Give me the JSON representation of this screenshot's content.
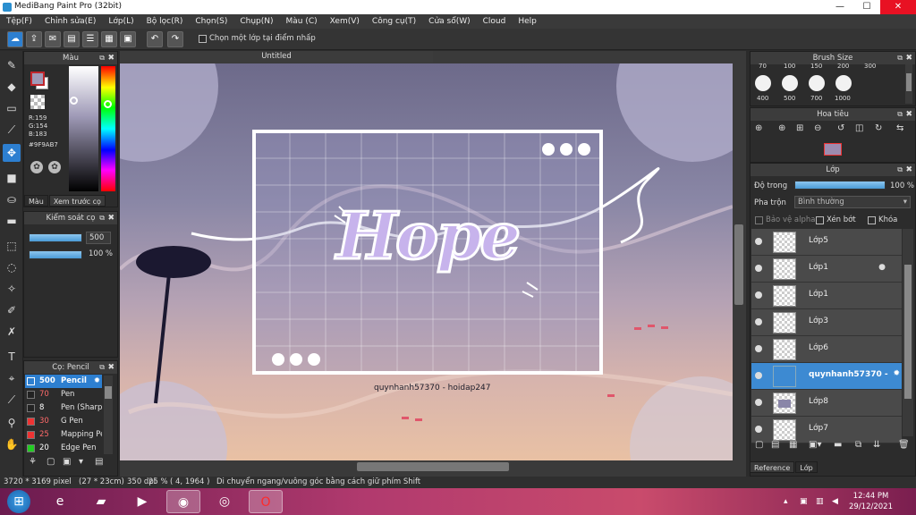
{
  "window": {
    "title": "MediBang Paint Pro (32bit)",
    "min": "—",
    "max": "☐",
    "close": "✕"
  },
  "menu": [
    "Tệp(F)",
    "Chỉnh sửa(E)",
    "Lớp(L)",
    "Bộ lọc(R)",
    "Chọn(S)",
    "Chụp(N)",
    "Màu (C)",
    "Xem(V)",
    "Công cụ(T)",
    "Cửa sổ(W)",
    "Cloud",
    "Help"
  ],
  "toolbar": {
    "select_layer_label": "Chọn một lớp tại điểm nhấp"
  },
  "color_panel": {
    "title": "Màu",
    "r": "R:159",
    "g": "G:154",
    "b": "B:183",
    "hex": "#9F9AB7",
    "current_color": "#9F9AB7",
    "tab_color": "Màu",
    "tab_preview": "Xem trước cọ"
  },
  "brush_control": {
    "title": "Kiểm soát cọ",
    "size_value": "500",
    "opacity_value": "100 %"
  },
  "brush_list": {
    "title": "Cọ: Pencil",
    "items": [
      {
        "size": "500",
        "name": "Pencil"
      },
      {
        "size": "70",
        "name": "Pen"
      },
      {
        "size": "8",
        "name": "Pen (Sharp)"
      },
      {
        "size": "30",
        "name": "G Pen"
      },
      {
        "size": "25",
        "name": "Mapping Pen"
      },
      {
        "size": "20",
        "name": "Edge Pen"
      }
    ]
  },
  "canvas": {
    "tab": "Untitled",
    "art_title": "Hope",
    "watermark": "quynhanh57370 - hoidap247"
  },
  "brush_size": {
    "title": "Brush Size",
    "top_labels": [
      "70",
      "100",
      "150",
      "200",
      "300"
    ],
    "bottom_labels": [
      "400",
      "500",
      "700",
      "1000"
    ]
  },
  "navigator": {
    "title": "Hoa tiêu"
  },
  "layers": {
    "title": "Lớp",
    "opacity_label": "Độ trong",
    "opacity_value": "100 %",
    "blend_label": "Pha trộn",
    "blend_value": "Bình thường",
    "protect_alpha": "Bảo vệ alpha",
    "clipping": "Xén bớt",
    "lock": "Khóa",
    "items": [
      "Lớp5",
      "Lớp1",
      "Lớp1",
      "Lớp3",
      "Lớp6",
      "quynhanh57370 -",
      "Lớp8",
      "Lớp7"
    ],
    "tab_reference": "Reference",
    "tab_layer": "Lớp"
  },
  "status": {
    "size": "3720 * 3169 pixel",
    "cm": "(27 * 23cm)",
    "dpi": "350 dpi",
    "zoom": "25 %",
    "coords": "( 4, 1964 )",
    "hint": "Di chuyển ngang/vuông góc bằng cách giữ phím Shift"
  },
  "taskbar": {
    "time": "12:44 PM",
    "date": "29/12/2021"
  }
}
